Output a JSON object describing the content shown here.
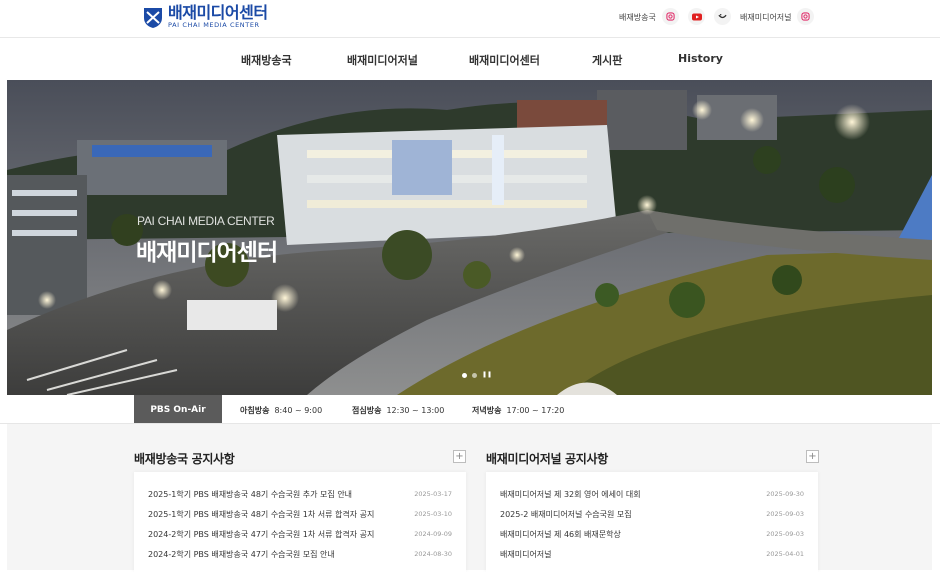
{
  "brand": {
    "name_ko": "배재미디어센터",
    "name_en": "PAI CHAI MEDIA CENTER",
    "color": "#1b4aa6"
  },
  "utility": {
    "broadcast_link": "배재방송국",
    "journal_link": "배재미디어저널",
    "icons": [
      "instagram-icon",
      "youtube-icon",
      "kakao-icon",
      "instagram-icon"
    ]
  },
  "nav": [
    "배재방송국",
    "배재미디어저널",
    "배재미디어센터",
    "게시판",
    "History"
  ],
  "hero": {
    "subtitle_en": "PAI CHAI MEDIA CENTER",
    "title_ko": "배재미디어센터",
    "slides": 2,
    "active_slide": 1
  },
  "onair": {
    "label": "PBS On-Air",
    "schedule": [
      {
        "name": "아침방송",
        "time": "8:40 ~ 9:00"
      },
      {
        "name": "점심방송",
        "time": "12:30 ~ 13:00"
      },
      {
        "name": "저녁방송",
        "time": "17:00 ~ 17:20"
      }
    ]
  },
  "notices": {
    "broadcast": {
      "title": "배재방송국 공지사항",
      "items": [
        {
          "title": "2025-1학기 PBS 배재방송국 48기 수습국원 추가 모집 안내",
          "date": "2025-03-17"
        },
        {
          "title": "2025-1학기 PBS 배재방송국 48기 수습국원 1차 서류 합격자 공지",
          "date": "2025-03-10"
        },
        {
          "title": "2024-2학기 PBS 배재방송국 47기 수습국원 1차 서류 합격자 공지",
          "date": "2024-09-09"
        },
        {
          "title": "2024-2학기 PBS 배재방송국 47기 수습국원 모집 안내",
          "date": "2024-08-30"
        }
      ]
    },
    "journal": {
      "title": "배재미디어저널 공지사항",
      "items": [
        {
          "title": "배재미디어저널 제 32회 영어 에세이 대회",
          "date": "2025-09-30"
        },
        {
          "title": "2025-2 배재미디어저널 수습국원 모집",
          "date": "2025-09-03"
        },
        {
          "title": "배재미디어저널 제 46회 배재문학상",
          "date": "2025-09-03"
        },
        {
          "title": "배재미디어저널",
          "date": "2025-04-01"
        }
      ]
    }
  }
}
